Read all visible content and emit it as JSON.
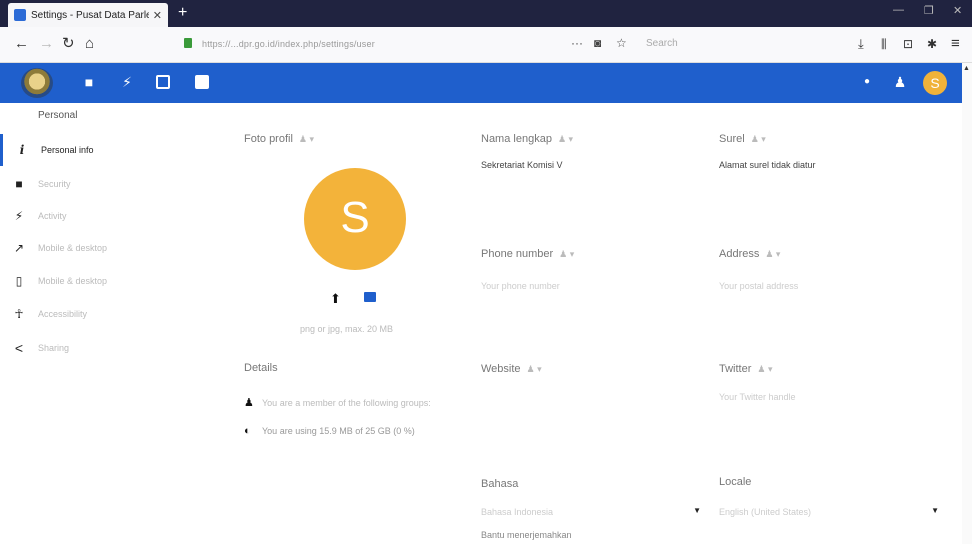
{
  "browser": {
    "tab_title": "Settings - Pusat Data Parlemen",
    "tab_close": "✕",
    "new_tab": "+",
    "url": "https://...dpr.go.id/index.php/settings/user",
    "search_placeholder": "Search"
  },
  "sidebar": {
    "section": "Personal",
    "items": [
      {
        "icon": "info-icon",
        "glyph": "i",
        "label": "Personal info"
      },
      {
        "icon": "lock-icon",
        "glyph": "🔒",
        "label": "Security"
      },
      {
        "icon": "bolt-icon",
        "glyph": "⚡",
        "label": "Activity"
      },
      {
        "icon": "external-link-icon",
        "glyph": "↗",
        "label": "Mobile & desktop"
      },
      {
        "icon": "phone-icon",
        "glyph": "▯",
        "label": "Mobile & desktop"
      },
      {
        "icon": "accessibility-icon",
        "glyph": "☥",
        "label": "Accessibility"
      },
      {
        "icon": "share-icon",
        "glyph": "<",
        "label": "Sharing"
      }
    ]
  },
  "profile": {
    "foto_label": "Foto profil",
    "avatar_letter": "S",
    "avatar_hint": "png or jpg, max. 20 MB",
    "details_label": "Details",
    "group_text": "You are a member of the following groups:",
    "quota_text": "You are using 15.9 MB of 25 GB (0 %)"
  },
  "fields": {
    "name_label": "Nama lengkap",
    "name_value": "Sekretariat Komisi V",
    "email_label": "Surel",
    "email_value": "Alamat surel tidak diatur",
    "phone_label": "Phone number",
    "phone_placeholder": "Your phone number",
    "address_label": "Address",
    "address_placeholder": "Your postal address",
    "website_label": "Website",
    "twitter_label": "Twitter",
    "twitter_placeholder": "Your Twitter handle",
    "language_label": "Bahasa",
    "language_value": "Bahasa Indonesia",
    "language_help": "Bantu menerjemahkan",
    "locale_label": "Locale",
    "locale_value": "English (United States)"
  }
}
